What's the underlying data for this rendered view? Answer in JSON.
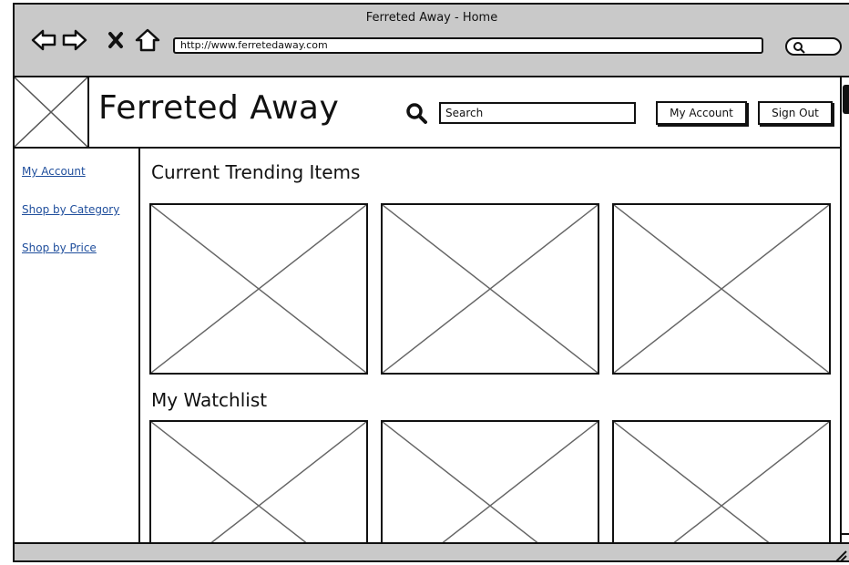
{
  "window": {
    "title": "Ferreted Away - Home"
  },
  "browser": {
    "url": "http://www.ferretedaway.com",
    "nav_icons": [
      "back-arrow-icon",
      "forward-arrow-icon",
      "stop-icon",
      "home-icon"
    ]
  },
  "header": {
    "site_title": "Ferreted Away",
    "search_placeholder": "Search",
    "my_account_label": "My Account",
    "sign_out_label": "Sign Out"
  },
  "sidebar": {
    "items": [
      {
        "label": "My Account"
      },
      {
        "label": "Shop by Category"
      },
      {
        "label": "Shop by Price"
      }
    ]
  },
  "main": {
    "trending_title": "Current Trending Items",
    "watchlist_title": "My Watchlist"
  },
  "colors": {
    "chrome": "#c9c9c9",
    "link": "#1f4e9c",
    "stroke": "#111111"
  }
}
